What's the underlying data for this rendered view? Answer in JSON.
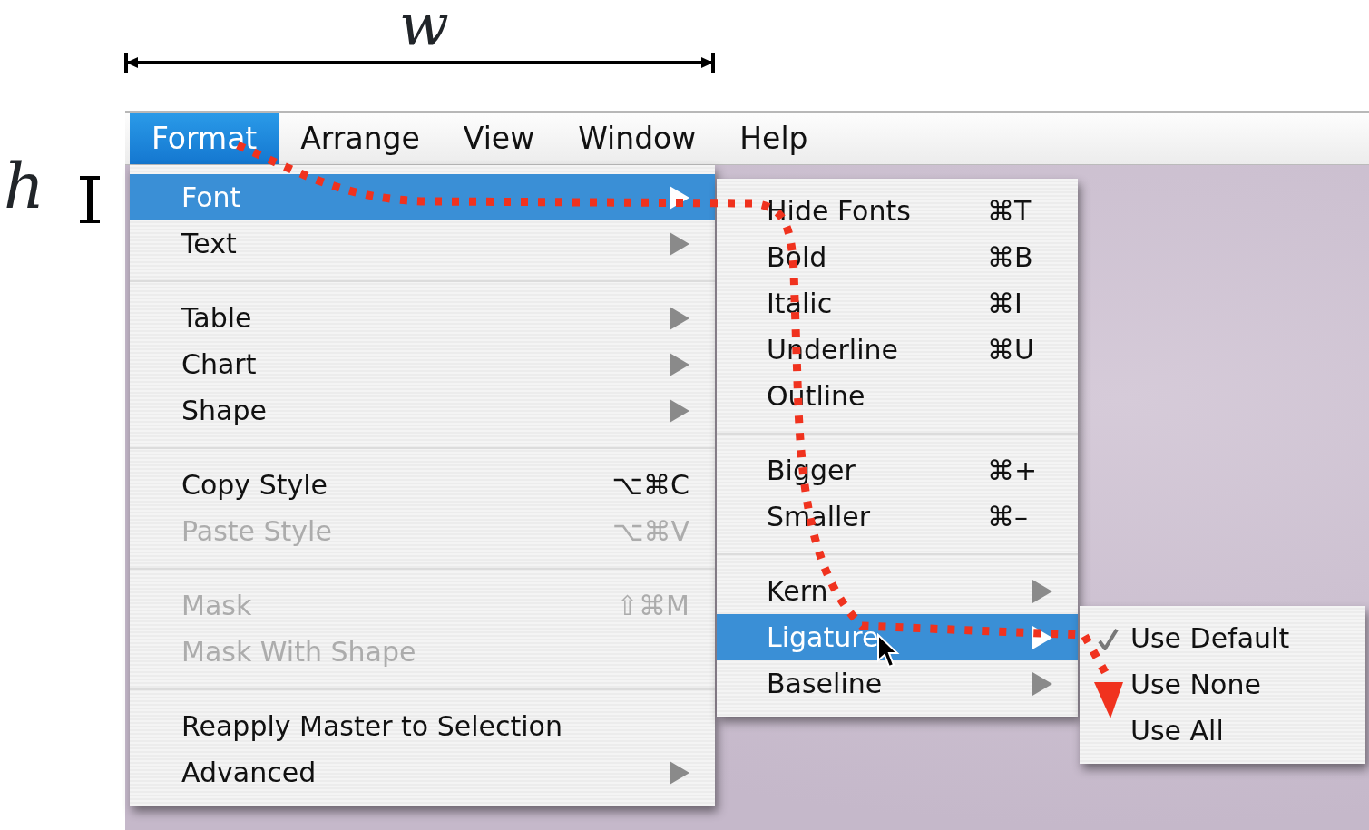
{
  "annotations": {
    "width_label": "w",
    "height_label": "h"
  },
  "menubar": [
    {
      "label": "Format",
      "selected": true
    },
    {
      "label": "Arrange",
      "selected": false
    },
    {
      "label": "View",
      "selected": false
    },
    {
      "label": "Window",
      "selected": false
    },
    {
      "label": "Help",
      "selected": false
    }
  ],
  "format_menu": [
    {
      "kind": "item",
      "label": "Font",
      "submenu": true,
      "selected": true,
      "disabled": false
    },
    {
      "kind": "item",
      "label": "Text",
      "submenu": true,
      "selected": false,
      "disabled": false
    },
    {
      "kind": "separator"
    },
    {
      "kind": "item",
      "label": "Table",
      "submenu": true,
      "selected": false,
      "disabled": false
    },
    {
      "kind": "item",
      "label": "Chart",
      "submenu": true,
      "selected": false,
      "disabled": false
    },
    {
      "kind": "item",
      "label": "Shape",
      "submenu": true,
      "selected": false,
      "disabled": false
    },
    {
      "kind": "separator"
    },
    {
      "kind": "item",
      "label": "Copy Style",
      "shortcut": "⌥⌘C",
      "submenu": false,
      "selected": false,
      "disabled": false
    },
    {
      "kind": "item",
      "label": "Paste Style",
      "shortcut": "⌥⌘V",
      "submenu": false,
      "selected": false,
      "disabled": true
    },
    {
      "kind": "separator"
    },
    {
      "kind": "item",
      "label": "Mask",
      "shortcut": "⇧⌘M",
      "submenu": false,
      "selected": false,
      "disabled": true
    },
    {
      "kind": "item",
      "label": "Mask With Shape",
      "submenu": false,
      "selected": false,
      "disabled": true
    },
    {
      "kind": "separator"
    },
    {
      "kind": "item",
      "label": "Reapply Master to Selection",
      "submenu": false,
      "selected": false,
      "disabled": false
    },
    {
      "kind": "item",
      "label": "Advanced",
      "submenu": true,
      "selected": false,
      "disabled": false
    }
  ],
  "font_menu": [
    {
      "kind": "item",
      "label": "Hide Fonts",
      "shortcut": "⌘T",
      "submenu": false,
      "selected": false,
      "disabled": false
    },
    {
      "kind": "item",
      "label": "Bold",
      "shortcut": "⌘B",
      "submenu": false,
      "selected": false,
      "disabled": false
    },
    {
      "kind": "item",
      "label": "Italic",
      "shortcut": "⌘I",
      "submenu": false,
      "selected": false,
      "disabled": false
    },
    {
      "kind": "item",
      "label": "Underline",
      "shortcut": "⌘U",
      "submenu": false,
      "selected": false,
      "disabled": false
    },
    {
      "kind": "item",
      "label": "Outline",
      "submenu": false,
      "selected": false,
      "disabled": false
    },
    {
      "kind": "separator"
    },
    {
      "kind": "item",
      "label": "Bigger",
      "shortcut": "⌘+",
      "submenu": false,
      "selected": false,
      "disabled": false
    },
    {
      "kind": "item",
      "label": "Smaller",
      "shortcut": "⌘–",
      "submenu": false,
      "selected": false,
      "disabled": false
    },
    {
      "kind": "separator"
    },
    {
      "kind": "item",
      "label": "Kern",
      "submenu": true,
      "selected": false,
      "disabled": false
    },
    {
      "kind": "item",
      "label": "Ligature",
      "submenu": true,
      "selected": true,
      "disabled": false
    },
    {
      "kind": "item",
      "label": "Baseline",
      "submenu": true,
      "selected": false,
      "disabled": false
    }
  ],
  "ligature_menu": [
    {
      "kind": "item",
      "label": "Use Default",
      "checked": true,
      "selected": false,
      "disabled": false
    },
    {
      "kind": "item",
      "label": "Use None",
      "checked": false,
      "selected": false,
      "disabled": false
    },
    {
      "kind": "item",
      "label": "Use All",
      "checked": false,
      "selected": false,
      "disabled": false
    }
  ]
}
